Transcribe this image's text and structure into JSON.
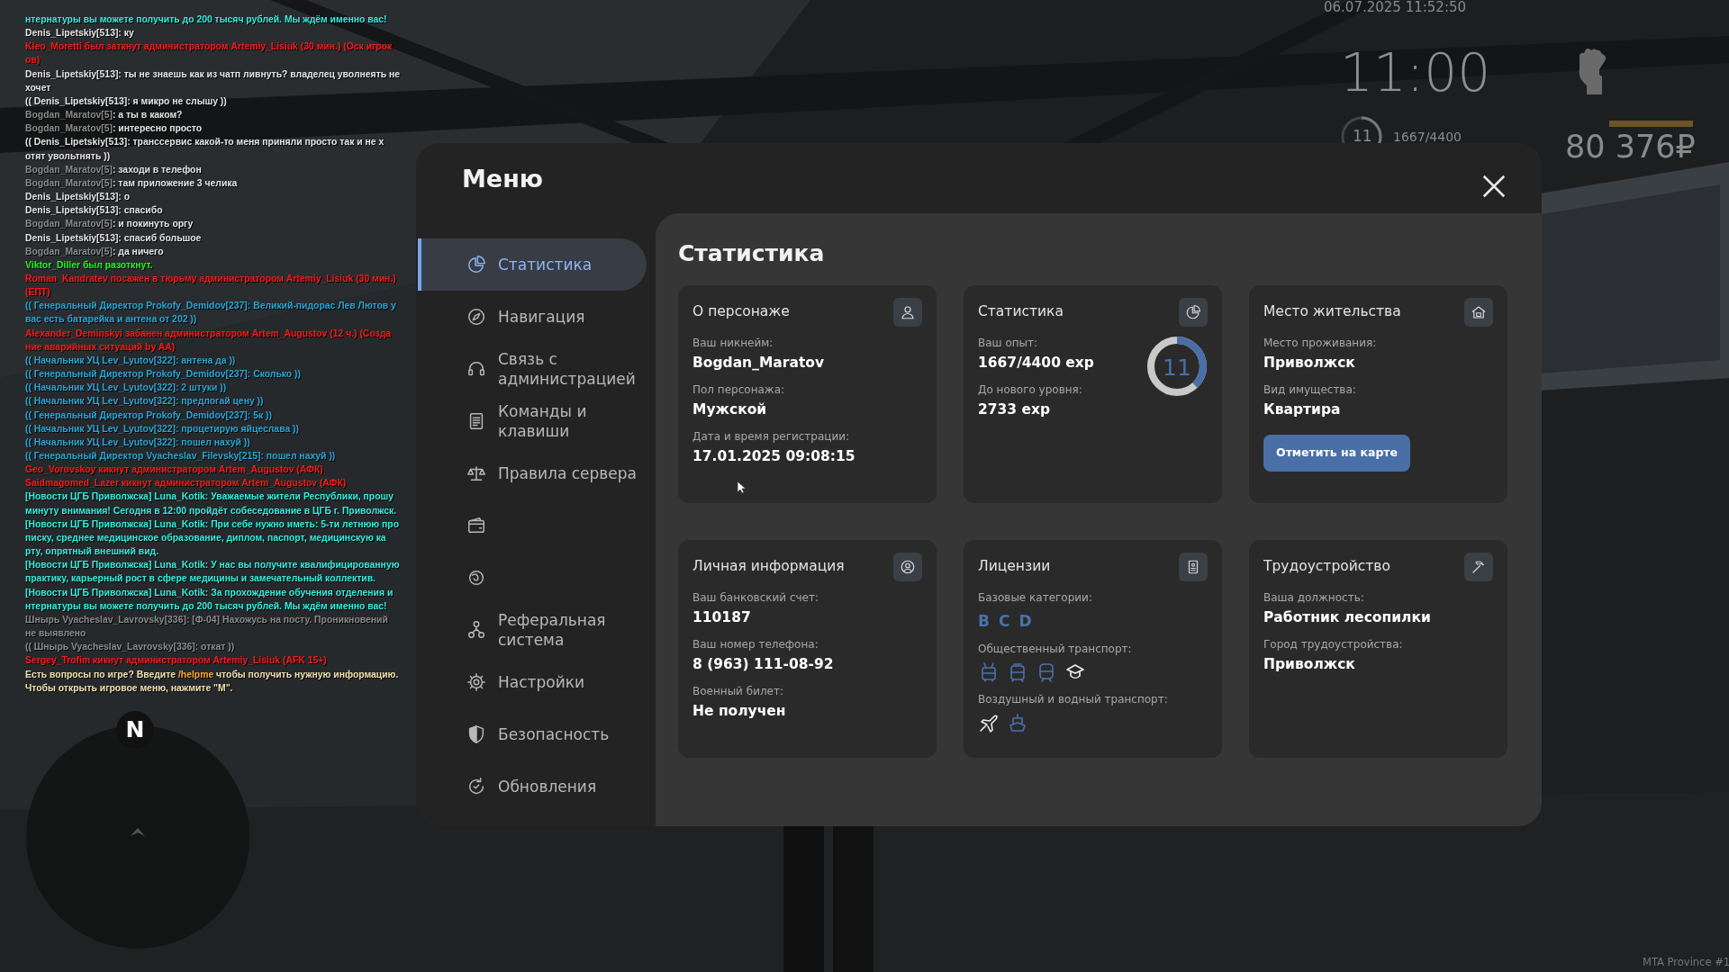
{
  "hud": {
    "datetime": "06.07.2025 11:52:50",
    "clock": "11:00",
    "level_label": "11",
    "level": 0.379,
    "exp": "1667/4400",
    "stat_bar": {
      "level": 1
    },
    "money": "80 376₽"
  },
  "chat": [
    {
      "parts": [
        {
          "text": "нтернатуры вы можете получить до 200 тысяч рублей. Мы ждём именно вас!",
          "color": "#33f0e0"
        }
      ]
    },
    {
      "parts": [
        {
          "text": "Denis_Lipetskiy[513]: ку",
          "color": "#e6e6e6"
        }
      ]
    },
    {
      "parts": [
        {
          "text": "Kleo_Moretti был заткнут администратором Artemiy_Lisiuk (30 мин.) (Оск игрок",
          "color": "#ff1a1a"
        }
      ]
    },
    {
      "parts": [
        {
          "text": "ов)",
          "color": "#ff1a1a"
        }
      ]
    },
    {
      "parts": [
        {
          "text": "Denis_Lipetskiy[513]: ты не знаешь как из чатп ливнуть? владелец уволнеять не",
          "color": "#e6e6e6"
        }
      ]
    },
    {
      "parts": [
        {
          "text": "хочет",
          "color": "#e6e6e6"
        }
      ]
    },
    {
      "parts": [
        {
          "text": "(( Denis_Lipetskiy[513]: я микро не слышу ))",
          "color": "#e6e6e6"
        }
      ]
    },
    {
      "parts": [
        {
          "text": "Bogdan_Maratov[5]",
          "color": "#8c8c8c"
        },
        {
          "text": ": а ты в каком?",
          "color": "#e6e6e6"
        }
      ]
    },
    {
      "parts": [
        {
          "text": "Bogdan_Maratov[5]",
          "color": "#8c8c8c"
        },
        {
          "text": ": интересно просто",
          "color": "#e6e6e6"
        }
      ]
    },
    {
      "parts": [
        {
          "text": "(( Denis_Lipetskiy[513]: транссервис какой-то меня приняли просто так и не х",
          "color": "#e6e6e6"
        }
      ]
    },
    {
      "parts": [
        {
          "text": "отят увольтнять ))",
          "color": "#e6e6e6"
        }
      ]
    },
    {
      "parts": [
        {
          "text": "Bogdan_Maratov[5]",
          "color": "#8c8c8c"
        },
        {
          "text": ": заходи в телефон",
          "color": "#e6e6e6"
        }
      ]
    },
    {
      "parts": [
        {
          "text": "Bogdan_Maratov[5]",
          "color": "#8c8c8c"
        },
        {
          "text": ": там приложение 3 челика",
          "color": "#e6e6e6"
        }
      ]
    },
    {
      "parts": [
        {
          "text": "Denis_Lipetskiy[513]: о",
          "color": "#e6e6e6"
        }
      ]
    },
    {
      "parts": [
        {
          "text": "Denis_Lipetskiy[513]: спасибо",
          "color": "#e6e6e6"
        }
      ]
    },
    {
      "parts": [
        {
          "text": "Bogdan_Maratov[5]",
          "color": "#8c8c8c"
        },
        {
          "text": ": и покинуть оргу",
          "color": "#e6e6e6"
        }
      ]
    },
    {
      "parts": [
        {
          "text": "Denis_Lipetskiy[513]: спасиб большое",
          "color": "#e6e6e6"
        }
      ]
    },
    {
      "parts": [
        {
          "text": "Bogdan_Maratov[5]",
          "color": "#8c8c8c"
        },
        {
          "text": ": да ничего",
          "color": "#e6e6e6"
        }
      ]
    },
    {
      "parts": [
        {
          "text": "Viktor_Diller был разоткнут.",
          "color": "#1aff1a"
        }
      ]
    },
    {
      "parts": [
        {
          "text": "Roman_Kandratev посажен в тюрьму администратором Artemiy_Lisiuk (30 мин.)",
          "color": "#ff1a1a"
        }
      ]
    },
    {
      "parts": [
        {
          "text": "(ЕПТ)",
          "color": "#ff1a1a"
        }
      ]
    },
    {
      "parts": [
        {
          "text": "(( Генеральный Директор Prokofy_Demidov[237]: Великий-пидорас Лев Лютов у",
          "color": "#2aa8d8"
        }
      ]
    },
    {
      "parts": [
        {
          "text": "вас есть батарейка и антена от 202 ))",
          "color": "#2aa8d8"
        }
      ]
    },
    {
      "parts": [
        {
          "text": "Alexander_Deminskyi забанен администратором Artem_Augustov (12 ч.) (Созда",
          "color": "#ff1a1a"
        }
      ]
    },
    {
      "parts": [
        {
          "text": "ние аварийных ситуаций by AA)",
          "color": "#ff1a1a"
        }
      ]
    },
    {
      "parts": [
        {
          "text": "(( Начальник УЦ Lev_Lyutov[322]: антена да ))",
          "color": "#2aa8d8"
        }
      ]
    },
    {
      "parts": [
        {
          "text": "(( Генеральный Директор Prokofy_Demidov[237]: Сколько ))",
          "color": "#2aa8d8"
        }
      ]
    },
    {
      "parts": [
        {
          "text": "(( Начальник УЦ Lev_Lyutov[322]: 2 штуки ))",
          "color": "#2aa8d8"
        }
      ]
    },
    {
      "parts": [
        {
          "text": "(( Начальник УЦ Lev_Lyutov[322]: предлогай цену ))",
          "color": "#2aa8d8"
        }
      ]
    },
    {
      "parts": [
        {
          "text": "(( Генеральный Директор Prokofy_Demidov[237]: 5к ))",
          "color": "#2aa8d8"
        }
      ]
    },
    {
      "parts": [
        {
          "text": "(( Начальник УЦ Lev_Lyutov[322]: процетирую яйцеслава ))",
          "color": "#2aa8d8"
        }
      ]
    },
    {
      "parts": [
        {
          "text": "(( Начальник УЦ Lev_Lyutov[322]: пошел нахуй ))",
          "color": "#2aa8d8"
        }
      ]
    },
    {
      "parts": [
        {
          "text": "(( Генеральный Директор Vyacheslav_Filevsky[215]: пошел нахуй ))",
          "color": "#2aa8d8"
        }
      ]
    },
    {
      "parts": [
        {
          "text": "Geo_Vorovskoy кикнут администратором Artem_Augustov (АФК)",
          "color": "#ff1a1a"
        }
      ]
    },
    {
      "parts": [
        {
          "text": "Saidmagomed_Lazer кикнут администратором Artem_Augustov (АФК)",
          "color": "#ff1a1a"
        }
      ]
    },
    {
      "parts": [
        {
          "text": "[Новости ЦГБ Приволжска] Luna_Kotik: Уважаемые жители Республики, прошу",
          "color": "#33f0e0"
        }
      ]
    },
    {
      "parts": [
        {
          "text": "минуту внимания! Сегодня в 12:00 пройдёт собеседование в ЦГБ г. Приволжск.",
          "color": "#33f0e0"
        }
      ]
    },
    {
      "parts": [
        {
          "text": "[Новости ЦГБ Приволжска] Luna_Kotik: При себе нужно иметь: 5-ти летнюю про",
          "color": "#33f0e0"
        }
      ]
    },
    {
      "parts": [
        {
          "text": "писку, среднее медицинское образование, диплом, паспорт, медицинскую ка",
          "color": "#33f0e0"
        }
      ]
    },
    {
      "parts": [
        {
          "text": "рту, опрятный внешний вид.",
          "color": "#33f0e0"
        }
      ]
    },
    {
      "parts": [
        {
          "text": "[Новости ЦГБ Приволжска] Luna_Kotik: У нас вы получите квалифицированную",
          "color": "#33f0e0"
        }
      ]
    },
    {
      "parts": [
        {
          "text": "практику, карьерный рост в сфере медицины и замечательный коллектив.",
          "color": "#33f0e0"
        }
      ]
    },
    {
      "parts": [
        {
          "text": "[Новости ЦГБ Приволжска] Luna_Kotik: За прохождение обучения отделения и",
          "color": "#33f0e0"
        }
      ]
    },
    {
      "parts": [
        {
          "text": "нтернатуры вы можете получить до 200 тысяч рублей. Мы ждём именно вас!",
          "color": "#33f0e0"
        }
      ]
    },
    {
      "parts": [
        {
          "text": "Шнырь Vyacheslav_Lavrovsky[336]: [Ф-04] Нахожусь на посту. Проникновений",
          "color": "#8c8c8c"
        }
      ]
    },
    {
      "parts": [
        {
          "text": "не выявлено",
          "color": "#8c8c8c"
        }
      ]
    },
    {
      "parts": [
        {
          "text": "(( Шнырь Vyacheslav_Lavrovsky[336]: откат ))",
          "color": "#8c8c8c"
        }
      ]
    },
    {
      "parts": [
        {
          "text": "Sergey_Trofim кикнут администратором Artemiy_Lisiuk (AFK 15+)",
          "color": "#ff1a1a"
        }
      ]
    },
    {
      "parts": [
        {
          "text": "Есть вопросы по игре? Введите ",
          "color": "#f2e2b0"
        },
        {
          "text": "/helpme",
          "color": "#ffa62a"
        },
        {
          "text": " чтобы получить нужную информацию.",
          "color": "#f2e2b0"
        }
      ]
    },
    {
      "parts": [
        {
          "text": "Чтобы открыть игровое меню, нажмите \"M\".",
          "color": "#f2e2b0"
        }
      ]
    }
  ],
  "menu": {
    "title": "Меню",
    "items": [
      {
        "label": "Статистика",
        "kind": "pie",
        "selected": true
      },
      {
        "label": "Навигация",
        "kind": "compass",
        "selected": false
      },
      {
        "label": "Связь с администрацией",
        "kind": "headset",
        "selected": false
      },
      {
        "label": "Команды и клавиши",
        "kind": "document",
        "selected": false
      },
      {
        "label": "Правила сервера",
        "kind": "scales",
        "selected": false
      },
      {
        "kind": "wallet",
        "selected": false
      },
      {
        "kind": "swirl",
        "selected": false
      },
      {
        "label": "Реферальная система",
        "kind": "network",
        "selected": false
      },
      {
        "label": "Настройки",
        "kind": "gear",
        "selected": false
      },
      {
        "label": "Безопасность",
        "kind": "shield",
        "selected": false
      },
      {
        "label": "Обновления",
        "kind": "refresh",
        "selected": false
      }
    ],
    "page": {
      "title": "Статистика",
      "cards": [
        {
          "title": "О персонаже",
          "kind": "person",
          "fields": [
            {
              "label": "Ваш никнейм:",
              "value": "Bogdan_Maratov"
            },
            {
              "label": "Пол персонажа:",
              "value": "Мужской"
            },
            {
              "label": "Дата и время регистрации:",
              "value": "17.01.2025 09:08:15"
            }
          ]
        },
        {
          "title": "Статистика",
          "kind": "pie",
          "fields": [
            {
              "label": "Ваш опыт:",
              "value": "1667/4400 exp"
            },
            {
              "label": "До нового уровня:",
              "value": "2733 exp"
            }
          ],
          "ring": {
            "label": "11",
            "level": 0.379
          }
        },
        {
          "title": "Место жительства",
          "kind": "house",
          "fields": [
            {
              "label": "Место проживания:",
              "value": "Приволжск"
            },
            {
              "label": "Вид имущества:",
              "value": "Квартира"
            }
          ],
          "button": "Отметить на карте"
        },
        {
          "title": "Личная информация",
          "kind": "user-circle",
          "fields": [
            {
              "label": "Ваш банковский счет:",
              "value": "110187"
            },
            {
              "label": "Ваш номер телефона:",
              "value": "8 (963) 111-08-92"
            },
            {
              "label": "Военный билет:",
              "value": "Не получен"
            }
          ]
        },
        {
          "title": "Лицензии",
          "kind": "badge",
          "groups": [
            {
              "label": "Базовые категории:",
              "kind": "letters",
              "items": [
                {
                  "text": "B"
                },
                {
                  "text": "C"
                },
                {
                  "text": "D"
                }
              ]
            },
            {
              "label": "Общественный транспорт:",
              "kind": "icons",
              "items": [
                {
                  "kind": "trolleybus",
                  "owned": true
                },
                {
                  "kind": "tram",
                  "owned": true
                },
                {
                  "kind": "train",
                  "owned": true
                },
                {
                  "kind": "cap",
                  "owned": false
                }
              ]
            },
            {
              "label": "Воздушный и водный транспорт:",
              "kind": "icons",
              "items": [
                {
                  "kind": "plane",
                  "owned": false
                },
                {
                  "kind": "ship",
                  "owned": true
                }
              ]
            }
          ]
        },
        {
          "title": "Трудоустройство",
          "kind": "pickaxe",
          "fields": [
            {
              "label": "Ваша должность:",
              "value": "Работник лесопилки"
            },
            {
              "label": "Город трудоустройства:",
              "value": "Приволжск"
            }
          ]
        }
      ]
    }
  },
  "minimap": {
    "north": "N"
  },
  "server_label": "MTA Province #1"
}
